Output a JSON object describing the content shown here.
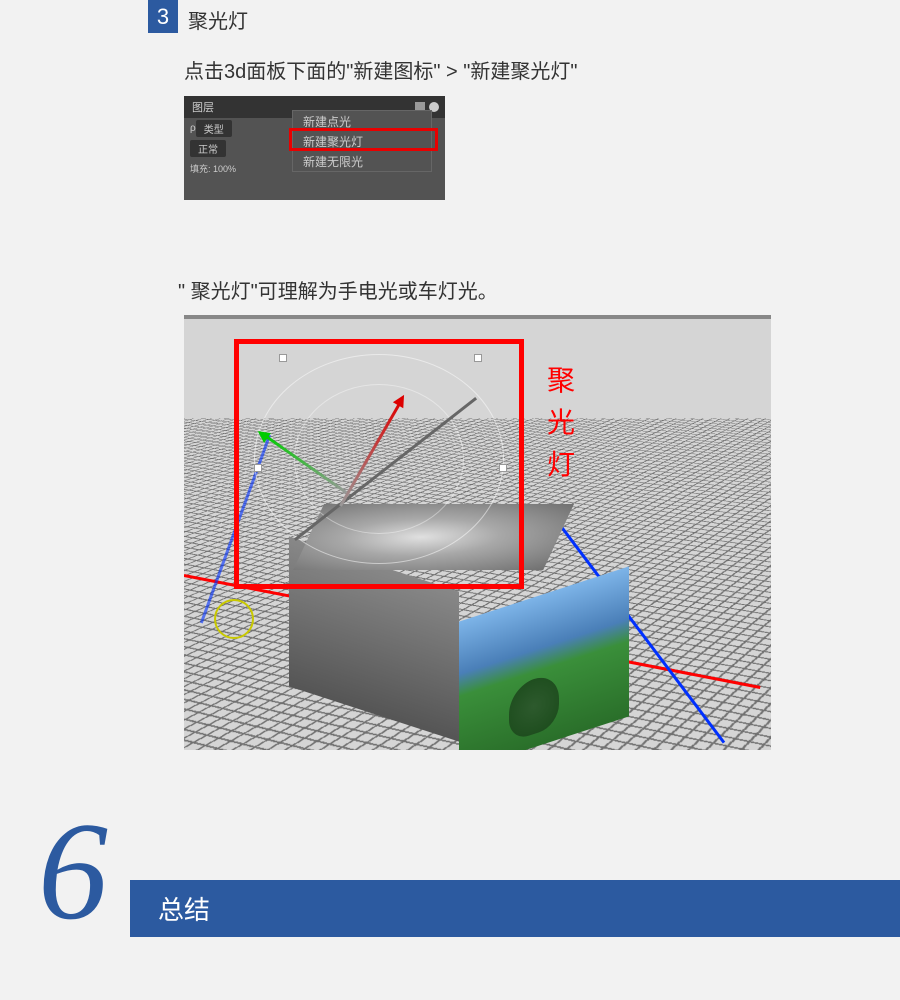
{
  "step": {
    "number": "3",
    "title": "聚光灯",
    "instruction": "点击3d面板下面的\"新建图标\" > \"新建聚光灯\"",
    "explanation": "\" 聚光灯\"可理解为手电光或车灯光。"
  },
  "panel": {
    "tab": "图层",
    "search_prefix": "ρ",
    "type_label": "类型",
    "mode": "正常",
    "fill_row": "填充: 100%"
  },
  "menu": {
    "items": [
      "新建点光",
      "新建聚光灯",
      "新建无限光"
    ]
  },
  "viewport": {
    "label_chars": [
      "聚",
      "光",
      "灯"
    ]
  },
  "section6": {
    "number": "6",
    "title": "总结"
  }
}
